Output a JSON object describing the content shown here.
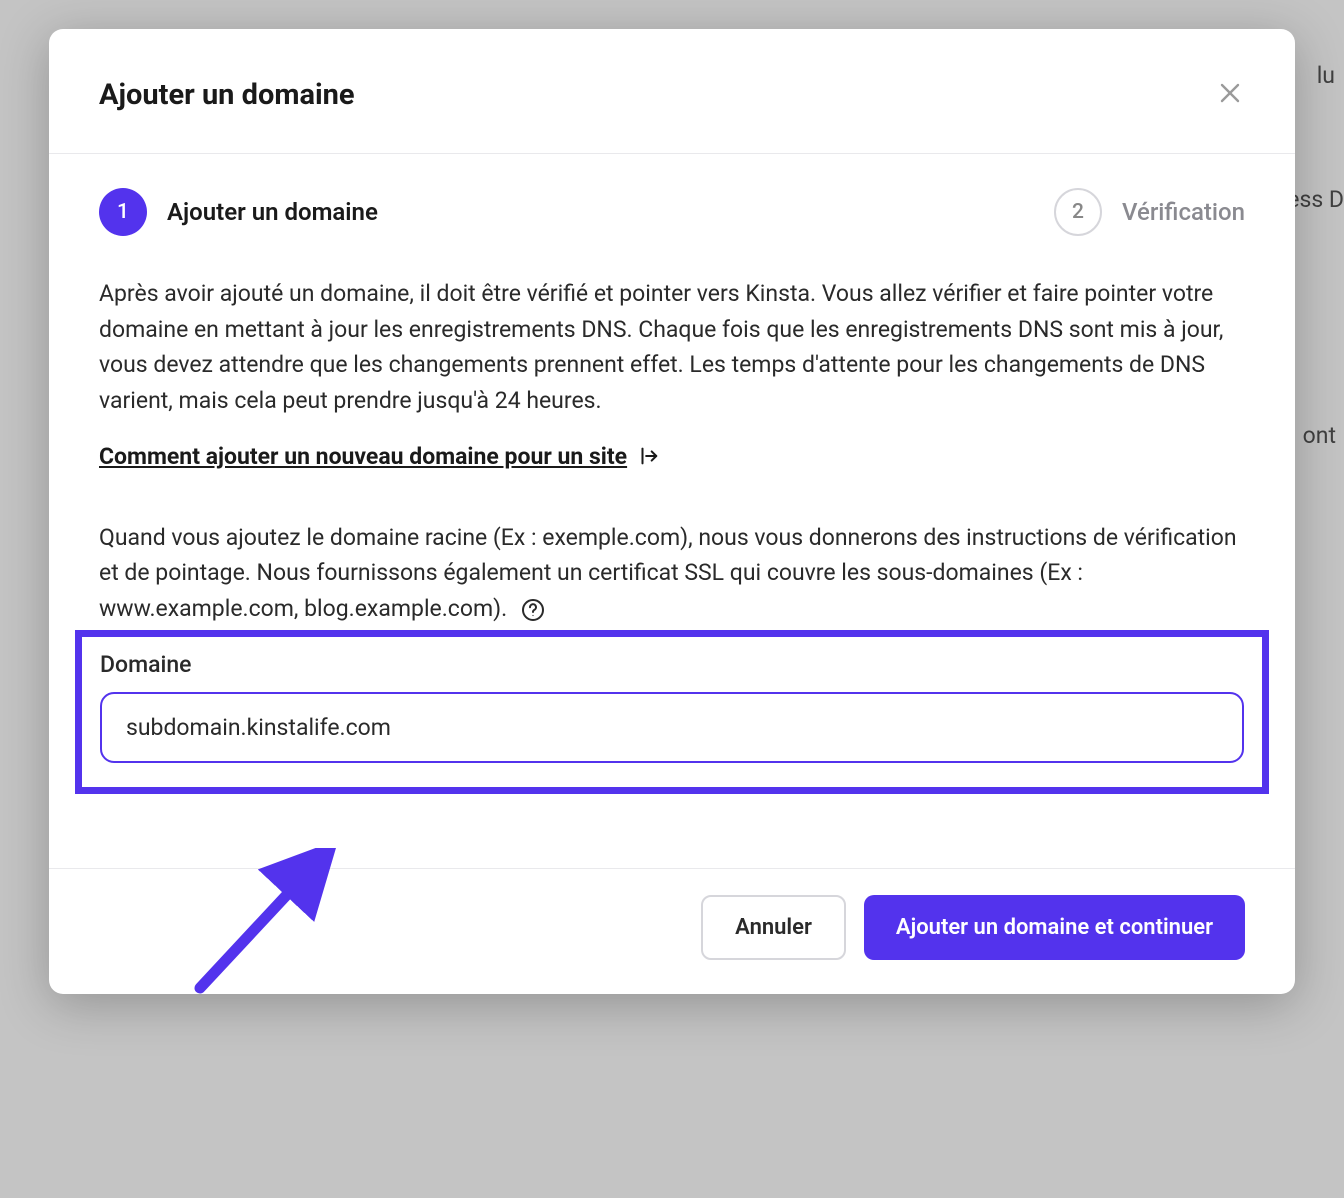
{
  "backdrop": {
    "text_top_right": "lu",
    "text_mid_right": "ress D",
    "text_lower_right": "ont"
  },
  "modal": {
    "title": "Ajouter un domaine",
    "steps": {
      "step1": {
        "num": "1",
        "label": "Ajouter un domaine"
      },
      "step2": {
        "num": "2",
        "label": "Vérification"
      }
    },
    "description": "Après avoir ajouté un domaine, il doit être vérifié et pointer vers Kinsta. Vous allez vérifier et faire pointer votre domaine en mettant à jour les enregistrements DNS. Chaque fois que les enregistrements DNS sont mis à jour, vous devez attendre que les changements prennent effet. Les temps d'attente pour les changements de DNS varient, mais cela peut prendre jusqu'à 24 heures.",
    "help_link": "Comment ajouter un nouveau domaine pour un site",
    "para2": "Quand vous ajoutez le domaine racine (Ex : exemple.com), nous vous donnerons des instructions de vérification et de pointage. Nous fournissons également un certificat SSL qui couvre les sous-domaines (Ex : www.example.com, blog.example.com).",
    "field": {
      "label": "Domaine",
      "value": "subdomain.kinstalife.com"
    },
    "buttons": {
      "cancel": "Annuler",
      "submit": "Ajouter un domaine et continuer"
    }
  },
  "colors": {
    "accent": "#5333ed"
  }
}
